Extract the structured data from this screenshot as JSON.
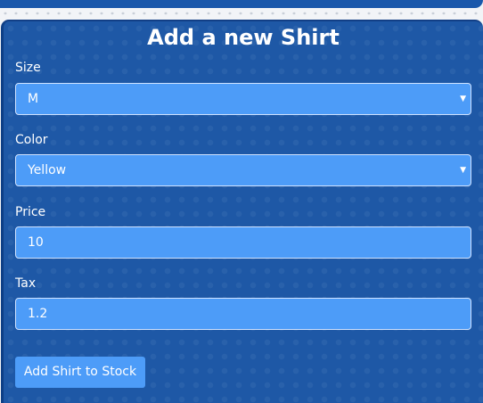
{
  "form": {
    "title": "Add a new Shirt",
    "size": {
      "label": "Size",
      "value": "M"
    },
    "color": {
      "label": "Color",
      "value": "Yellow"
    },
    "price": {
      "label": "Price",
      "value": "10"
    },
    "tax": {
      "label": "Tax",
      "value": "1.2"
    },
    "submit_label": "Add Shirt to Stock"
  },
  "icons": {
    "select_caret": "chevron-down-icon"
  },
  "colors": {
    "panel": "#1e58a6",
    "field": "#4d9cf8",
    "text": "#ffffff"
  }
}
